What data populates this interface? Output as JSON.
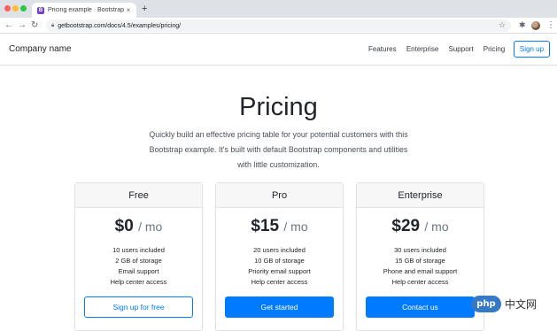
{
  "browser": {
    "tab_favicon": "B",
    "tab_title": "Pricing example · Bootstrap",
    "tab_close": "×",
    "new_tab": "+",
    "url": "getbootstrap.com/docs/4.5/examples/pricing/",
    "icons": {
      "back": "back-arrow-icon",
      "forward": "forward-arrow-icon",
      "reload": "reload-icon",
      "lock": "lock-icon",
      "star": "star-icon",
      "extensions": "puzzle-icon",
      "menu": "kebab-menu-icon"
    }
  },
  "header": {
    "brand": "Company name",
    "nav": [
      "Features",
      "Enterprise",
      "Support",
      "Pricing"
    ],
    "signup": "Sign up"
  },
  "hero": {
    "title": "Pricing",
    "lead_line1": "Quickly build an effective pricing table for your potential customers with this",
    "lead_line2": "Bootstrap example. It's built with default Bootstrap components and utilities",
    "lead_line3": "with little customization."
  },
  "plans": [
    {
      "name": "Free",
      "price": "$0",
      "period": "/ mo",
      "features": [
        "10 users included",
        "2 GB of storage",
        "Email support",
        "Help center access"
      ],
      "button": "Sign up for free"
    },
    {
      "name": "Pro",
      "price": "$15",
      "period": "/ mo",
      "features": [
        "20 users included",
        "10 GB of storage",
        "Priority email support",
        "Help center access"
      ],
      "button": "Get started"
    },
    {
      "name": "Enterprise",
      "price": "$29",
      "period": "/ mo",
      "features": [
        "30 users included",
        "15 GB of storage",
        "Phone and email support",
        "Help center access"
      ],
      "button": "Contact us"
    }
  ],
  "watermark": {
    "badge": "php",
    "text": "中文网"
  },
  "colors": {
    "primary": "#007bff",
    "header_bg": "#f7f7f7",
    "text": "#212529"
  }
}
